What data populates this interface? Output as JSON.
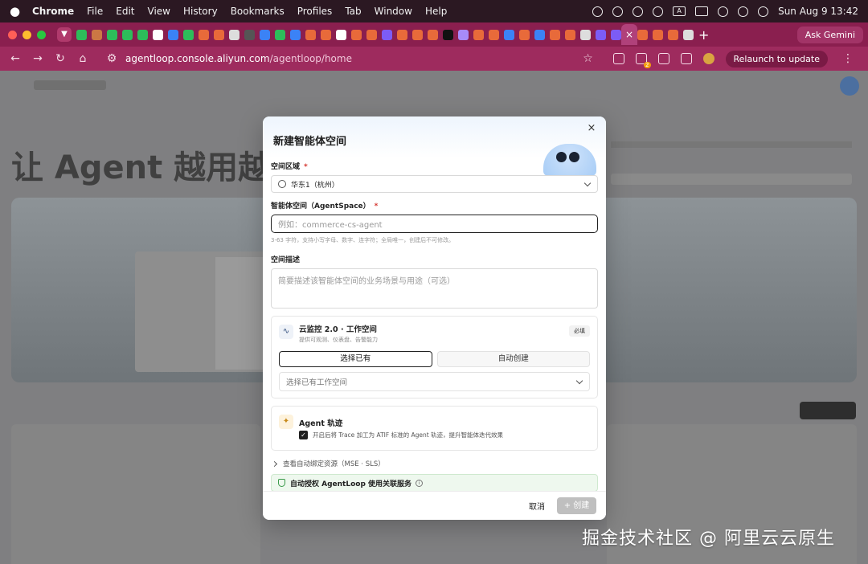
{
  "menubar": {
    "app": "Chrome",
    "items": [
      "File",
      "Edit",
      "View",
      "History",
      "Bookmarks",
      "Profiles",
      "Tab",
      "Window",
      "Help"
    ],
    "clock": "Sun Aug 9  13:42"
  },
  "tabstrip": {
    "ask_gemini": "Ask Gemini",
    "active_tab_close": "×",
    "new_tab": "+"
  },
  "addressbar": {
    "url_host": "agentloop.console.aliyun.com",
    "url_path": "/agentloop/home",
    "relaunch": "Relaunch to update",
    "extension_badge": "2"
  },
  "background_page": {
    "hero_title": "让 Agent 越用越"
  },
  "dialog": {
    "title": "新建智能体空间",
    "close": "×",
    "region": {
      "label": "空间区域",
      "required": "*",
      "value": "华东1（杭州）"
    },
    "agentspace": {
      "label": "智能体空间（AgentSpace）",
      "required": "*",
      "placeholder": "例如：commerce-cs-agent",
      "hint": "3-63 字符，支持小写字母、数字、连字符；全局唯一，创建后不可修改。"
    },
    "description": {
      "label": "空间描述",
      "placeholder": "简要描述该智能体空间的业务场景与用途（可选）"
    },
    "cloudmonitor": {
      "title": "云监控 2.0 · 工作空间",
      "subtitle": "提供可观测、仪表盘、告警能力",
      "badge": "必填",
      "options": [
        "选择已有",
        "自动创建"
      ],
      "selected_option": "选择已有",
      "select_placeholder": "选择已有工作空间"
    },
    "trace": {
      "title": "Agent 轨迹",
      "checkbox_label": "开启后将 Trace 加工为 ATIF 标准的 Agent 轨迹，提升智能体迭代效果",
      "checked": true
    },
    "expander": "查看自动绑定资源（MSE · SLS）",
    "auth": "自动授权 AgentLoop 使用关联服务",
    "cancel": "取消",
    "create": "+ 创建"
  },
  "watermark": "掘金技术社区 @ 阿里云云原生",
  "colors": {
    "tab_strip": "#8a1f4f",
    "address_bar": "#9e2b5e",
    "primary_text": "#1f1f1f",
    "required": "#d4352f",
    "auth_bg": "#eef8ee"
  }
}
